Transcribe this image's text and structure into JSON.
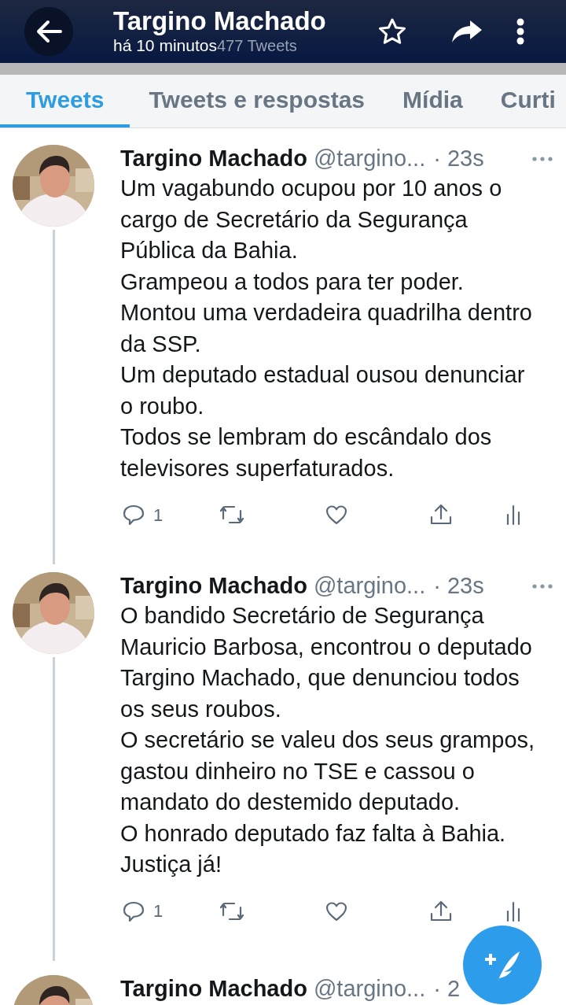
{
  "header": {
    "title": "Targino Machado",
    "subtitle": "há 10 minutos",
    "tweet_count": "477 Tweets"
  },
  "tabs": [
    {
      "label": "Tweets",
      "selected": true
    },
    {
      "label": "Tweets e respostas",
      "selected": false
    },
    {
      "label": "Mídia",
      "selected": false
    },
    {
      "label": "Curti",
      "selected": false
    }
  ],
  "tweets": [
    {
      "name": "Targino Machado",
      "handle": "@targino...",
      "time": "· 23s",
      "text": "Um vagabundo ocupou por 10 anos o cargo de Secretário da Segurança Pública da Bahia.\nGrampeou a todos para ter poder.\nMontou uma verdadeira quadrilha dentro da SSP.\nUm deputado estadual ousou denunciar o roubo.\nTodos se lembram do escândalo dos televisores superfaturados.",
      "replies": "1"
    },
    {
      "name": "Targino Machado",
      "handle": "@targino...",
      "time": "· 23s",
      "text": "O bandido Secretário de Segurança Mauricio Barbosa, encontrou o deputado Targino Machado, que denunciou todos os seus roubos.\nO secretário se valeu dos seus grampos, gastou dinheiro no TSE e cassou o mandato do destemido deputado.\nO honrado deputado faz falta à Bahia.\nJustiça já!",
      "replies": "1"
    },
    {
      "name": "Targino Machado",
      "handle": "@targino...",
      "time": "· 2"
    }
  ]
}
